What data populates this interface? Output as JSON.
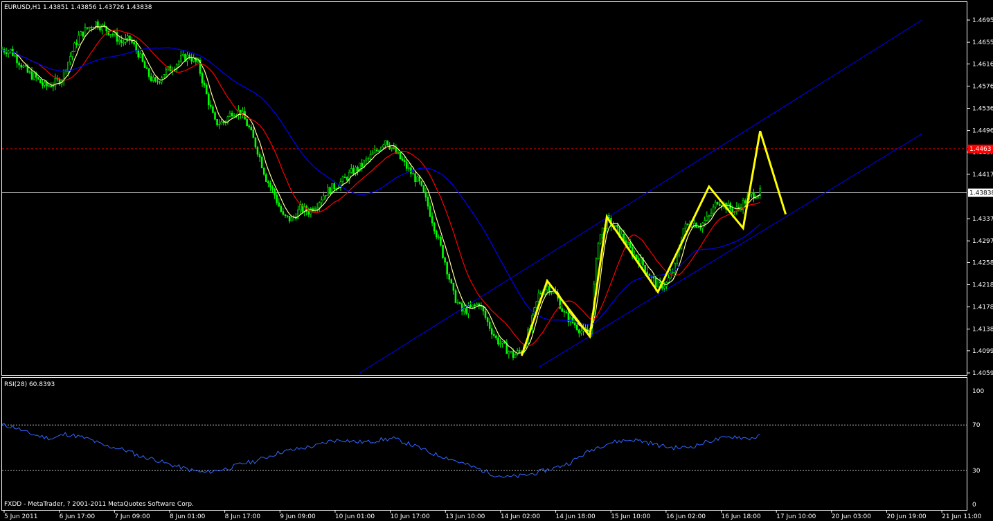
{
  "header": {
    "symbol": "EURUSD,H1",
    "quote": "1.43851 1.43856 1.43726 1.43838"
  },
  "price_axis": {
    "labels": [
      "1.46950",
      "1.46550",
      "1.46160",
      "1.45760",
      "1.45360",
      "1.44960",
      "1.44570",
      "1.44170",
      "1.43370",
      "1.42970",
      "1.42580",
      "1.42180",
      "1.41780",
      "1.41380",
      "1.40990",
      "1.40590"
    ],
    "current_tag": "1.43838",
    "level_tag": "1.4463"
  },
  "time_axis": {
    "labels": [
      "5 Jun 2011",
      "6 Jun 17:00",
      "7 Jun 09:00",
      "8 Jun 01:00",
      "8 Jun 17:00",
      "9 Jun 09:00",
      "10 Jun 01:00",
      "10 Jun 17:00",
      "13 Jun 10:00",
      "14 Jun 02:00",
      "14 Jun 18:00",
      "15 Jun 10:00",
      "16 Jun 02:00",
      "16 Jun 18:00",
      "17 Jun 10:00",
      "20 Jun 03:00",
      "20 Jun 19:00",
      "21 Jun 11:00"
    ]
  },
  "indicator": {
    "name": "RSI(28) 60.8393",
    "labels": [
      "100",
      "70",
      "30",
      "0"
    ]
  },
  "footer": {
    "copyright": "FXDD - MetaTrader, ? 2001-2011 MetaQuotes Software Corp."
  },
  "colors": {
    "background": "#000000",
    "candles": "#00ff00",
    "ma_fast": "#ffff99",
    "ma_mid": "#ff0000",
    "ma_slow": "#0000ff",
    "rsi": "#3366ff",
    "zigzag": "#ffff00",
    "channel": "#0000ff",
    "level": "#ff0000",
    "current": "#c0c0c0"
  },
  "chart_data": [
    {
      "type": "candlestick",
      "title": "EURUSD,H1",
      "ylim": [
        1.4059,
        1.4695
      ],
      "close_path": [
        [
          0,
          1.4642
        ],
        [
          1,
          1.464
        ],
        [
          2,
          1.462
        ],
        [
          3,
          1.46
        ],
        [
          4,
          1.459
        ],
        [
          5,
          1.4575
        ],
        [
          6,
          1.458
        ],
        [
          7,
          1.459
        ],
        [
          8,
          1.463
        ],
        [
          9,
          1.4665
        ],
        [
          10,
          1.468
        ],
        [
          11,
          1.469
        ],
        [
          12,
          1.468
        ],
        [
          13,
          1.467
        ],
        [
          14,
          1.4655
        ],
        [
          15,
          1.466
        ],
        [
          16,
          1.4635
        ],
        [
          17,
          1.46
        ],
        [
          18,
          1.458
        ],
        [
          19,
          1.46
        ],
        [
          20,
          1.461
        ],
        [
          21,
          1.4625
        ],
        [
          22,
          1.463
        ],
        [
          23,
          1.4615
        ],
        [
          24,
          1.456
        ],
        [
          25,
          1.451
        ],
        [
          26,
          1.451
        ],
        [
          27,
          1.453
        ],
        [
          28,
          1.453
        ],
        [
          29,
          1.45
        ],
        [
          30,
          1.446
        ],
        [
          31,
          1.441
        ],
        [
          32,
          1.438
        ],
        [
          33,
          1.434
        ],
        [
          34,
          1.4335
        ],
        [
          35,
          1.4355
        ],
        [
          36,
          1.435
        ],
        [
          37,
          1.4365
        ],
        [
          38,
          1.4385
        ],
        [
          39,
          1.4395
        ],
        [
          40,
          1.4405
        ],
        [
          41,
          1.442
        ],
        [
          42,
          1.443
        ],
        [
          43,
          1.4445
        ],
        [
          44,
          1.446
        ],
        [
          45,
          1.448
        ],
        [
          46,
          1.446
        ],
        [
          47,
          1.444
        ],
        [
          48,
          1.442
        ],
        [
          49,
          1.44
        ],
        [
          50,
          1.436
        ],
        [
          51,
          1.431
        ],
        [
          52,
          1.426
        ],
        [
          53,
          1.42
        ],
        [
          54,
          1.417
        ],
        [
          55,
          1.4175
        ],
        [
          56,
          1.4185
        ],
        [
          57,
          1.415
        ],
        [
          58,
          1.412
        ],
        [
          59,
          1.4105
        ],
        [
          60,
          1.409
        ],
        [
          61,
          1.41
        ],
        [
          62,
          1.414
        ],
        [
          63,
          1.42
        ],
        [
          64,
          1.4215
        ],
        [
          65,
          1.42
        ],
        [
          66,
          1.4165
        ],
        [
          67,
          1.415
        ],
        [
          68,
          1.4135
        ],
        [
          69,
          1.413
        ],
        [
          70,
          1.43
        ],
        [
          71,
          1.4335
        ],
        [
          72,
          1.432
        ],
        [
          73,
          1.43
        ],
        [
          74,
          1.4275
        ],
        [
          75,
          1.426
        ],
        [
          76,
          1.4235
        ],
        [
          77,
          1.4215
        ],
        [
          78,
          1.422
        ],
        [
          79,
          1.425
        ],
        [
          80,
          1.432
        ],
        [
          81,
          1.433
        ],
        [
          82,
          1.4325
        ],
        [
          83,
          1.434
        ],
        [
          84,
          1.437
        ],
        [
          85,
          1.436
        ],
        [
          86,
          1.435
        ],
        [
          87,
          1.4365
        ],
        [
          88,
          1.438
        ],
        [
          89,
          1.4384
        ]
      ],
      "series": [
        {
          "name": "MA fast",
          "color": "#ffff99"
        },
        {
          "name": "MA mid",
          "color": "#ff0000"
        },
        {
          "name": "MA slow",
          "color": "#0000ff"
        }
      ],
      "zigzag": [
        [
          61,
          1.409
        ],
        [
          64,
          1.4225
        ],
        [
          69,
          1.4125
        ],
        [
          71,
          1.434
        ],
        [
          77,
          1.4205
        ],
        [
          83,
          1.4395
        ],
        [
          87,
          1.432
        ],
        [
          89,
          1.4495
        ],
        [
          92,
          1.4345
        ]
      ],
      "channel_upper": [
        [
          42,
          1.4059
        ],
        [
          108,
          1.4695
        ]
      ],
      "channel_lower": [
        [
          63,
          1.4069
        ],
        [
          108,
          1.449
        ]
      ],
      "horizontal_levels": [
        1.4463,
        1.43838
      ]
    },
    {
      "type": "line",
      "title": "RSI(28) 60.8393",
      "ylim": [
        0,
        100
      ],
      "levels": [
        30,
        70
      ],
      "values": [
        [
          0,
          70
        ],
        [
          3,
          68
        ],
        [
          6,
          63
        ],
        [
          9,
          60
        ],
        [
          12,
          58
        ],
        [
          15,
          62
        ],
        [
          18,
          60
        ],
        [
          21,
          57
        ],
        [
          24,
          52
        ],
        [
          27,
          50
        ],
        [
          30,
          47
        ],
        [
          33,
          42
        ],
        [
          36,
          40
        ],
        [
          39,
          36
        ],
        [
          42,
          33
        ],
        [
          45,
          30
        ],
        [
          48,
          28
        ],
        [
          51,
          30
        ],
        [
          54,
          32
        ],
        [
          57,
          36
        ],
        [
          60,
          38
        ],
        [
          63,
          42
        ],
        [
          66,
          46
        ],
        [
          69,
          48
        ],
        [
          72,
          50
        ],
        [
          75,
          52
        ],
        [
          78,
          56
        ],
        [
          81,
          57
        ],
        [
          84,
          55
        ],
        [
          87,
          55
        ],
        [
          90,
          57
        ],
        [
          93,
          58
        ],
        [
          96,
          54
        ],
        [
          99,
          50
        ],
        [
          102,
          45
        ],
        [
          105,
          42
        ],
        [
          108,
          38
        ],
        [
          111,
          34
        ],
        [
          114,
          30
        ],
        [
          117,
          26
        ],
        [
          120,
          24
        ],
        [
          123,
          25
        ],
        [
          126,
          27
        ],
        [
          129,
          30
        ],
        [
          132,
          33
        ],
        [
          135,
          37
        ],
        [
          138,
          44
        ],
        [
          141,
          50
        ],
        [
          144,
          54
        ],
        [
          147,
          56
        ],
        [
          150,
          57
        ],
        [
          153,
          55
        ],
        [
          156,
          52
        ],
        [
          159,
          50
        ],
        [
          162,
          50
        ],
        [
          165,
          52
        ],
        [
          168,
          56
        ],
        [
          171,
          58
        ],
        [
          174,
          60
        ],
        [
          177,
          58
        ],
        [
          180,
          60
        ]
      ]
    }
  ]
}
